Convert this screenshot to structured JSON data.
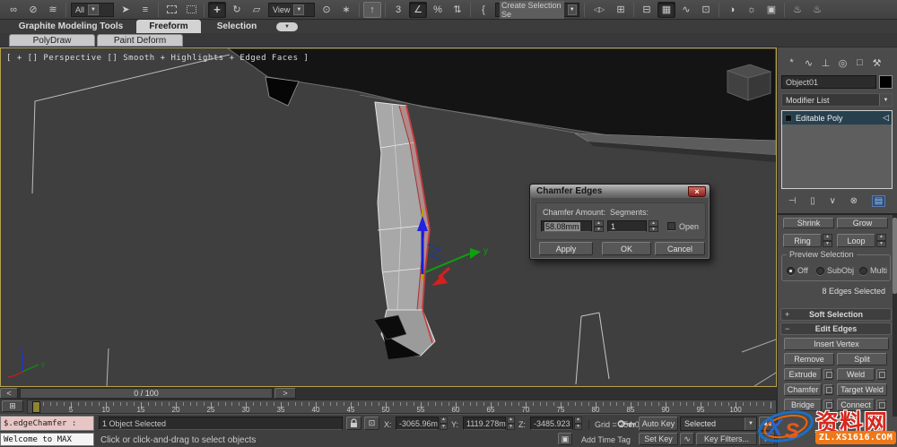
{
  "toolbar": {
    "all_dropdown": "All",
    "view_dropdown": "View",
    "selection_set_field": "Create Selection Se"
  },
  "icons": {
    "link": "∞",
    "unlink": "⊘",
    "bind_spacewarp": "≋",
    "select": "➤",
    "select_by_name": "≡",
    "move": "+",
    "rotate": "↻",
    "scale": "▱",
    "use_center": "⊙",
    "manipulate": "∗",
    "kbd_override": "↑",
    "snap_3d": "3",
    "snap_angle": "∠",
    "snap_percent": "%",
    "snap_spinner": "⇅",
    "named_sets": "{",
    "mirror": "◁▷",
    "align": "⊞",
    "layers": "⊟",
    "toolbox": "▦",
    "curve_editor": "∿",
    "schematic": "⊡",
    "material": "◑",
    "render_setup": "☼",
    "rendered_frame": "▣",
    "render": "♨",
    "dropdown": "▼",
    "spin_up": "▲",
    "spin_down": "▼",
    "close": "×",
    "ribbon_min": "▼",
    "panel_create": "*",
    "panel_modify": "∿",
    "panel_hierarchy": "⊥",
    "panel_motion": "◎",
    "panel_display": "□",
    "panel_utilities": "⚒",
    "stack_pin": "⊣",
    "stack_show_end": "▯",
    "stack_unique": "∨",
    "stack_remove": "⊗",
    "stack_config": "▤",
    "stack_item_pin": "◁",
    "stack_item_box": "▪",
    "rollout_plus": "+",
    "rollout_minus": "−",
    "track_view_open": "⊞",
    "abs_mode": "⊡",
    "isolate": "▣",
    "set_key_curve": "∿",
    "play_prev": "◀◀",
    "play_back": "◀",
    "play_fwd": "▶",
    "trackbar_prev": "<",
    "trackbar_next": ">"
  },
  "ribbon": {
    "tab_graphite": "Graphite Modeling Tools",
    "tab_freeform": "Freeform",
    "tab_selection": "Selection",
    "sub_polydraw": "PolyDraw",
    "sub_paintdeform": "Paint Deform"
  },
  "viewport": {
    "label": "[ + [] Perspective [] Smooth + Highlights + Edged Faces ]",
    "gizmo_y": "y",
    "tripod_y": "y",
    "tripod_z": "z"
  },
  "dialog": {
    "title": "Chamfer Edges",
    "amount_label": "Chamfer Amount:",
    "amount_value": "58.08mm",
    "segments_label": "Segments:",
    "segments_value": "1",
    "open_label": "Open",
    "apply": "Apply",
    "ok": "OK",
    "cancel": "Cancel"
  },
  "panel": {
    "object_name": "Object01",
    "modifier_list": "Modifier List",
    "stack_item": "Editable Poly",
    "shrink": "Shrink",
    "grow": "Grow",
    "ring": "Ring",
    "loop": "Loop",
    "preview_title": "Preview Selection",
    "preview_off": "Off",
    "preview_subobj": "SubObj",
    "preview_multi": "Multi",
    "selection_status": "8 Edges Selected",
    "soft_selection": "Soft Selection",
    "edit_edges": "Edit Edges",
    "insert_vertex": "Insert Vertex",
    "remove": "Remove",
    "split": "Split",
    "extrude": "Extrude",
    "weld": "Weld",
    "chamfer": "Chamfer",
    "target_weld": "Target Weld",
    "bridge": "Bridge",
    "connect": "Connect"
  },
  "trackbar": {
    "range": "0 / 100"
  },
  "timeline": {
    "tick_labels": [
      "5",
      "10",
      "15",
      "20",
      "25",
      "30",
      "35",
      "40",
      "45",
      "50",
      "55",
      "60",
      "65",
      "70",
      "75",
      "80",
      "85",
      "90",
      "95",
      "100"
    ]
  },
  "statusbar": {
    "script_line": "$.edgeChamfer :",
    "welcome_line": "Welcome to MAX",
    "selection_status": "1 Object Selected",
    "prompt": "Click or click-and-drag to select objects",
    "x_label": "X:",
    "x_value": "-3065.96m",
    "y_label": "Y:",
    "y_value": "1119.278m",
    "z_label": "Z:",
    "z_value": "-3485.923",
    "grid": "Grid = 254.0mm",
    "add_time_tag": "Add Time Tag",
    "auto_key": "Auto Key",
    "set_key": "Set Key",
    "key_mode": "Selected",
    "key_filters": "Key Filters..."
  },
  "watermark": {
    "logo_x": "X",
    "logo_s": "S",
    "site_name": "资料网",
    "site_url": "ZL.XS1616.COM"
  },
  "colors": {
    "selected_edge": "#c23b3b",
    "gizmo_x": "#d42020",
    "gizmo_y": "#0fa00f",
    "gizmo_z": "#1b1bd6",
    "viewport_border": "#b5a14e",
    "watermark_orange": "#f07818",
    "watermark_red": "#d4291e",
    "watermark_blue": "#2b66c9",
    "dialog_close": "#b03030"
  }
}
